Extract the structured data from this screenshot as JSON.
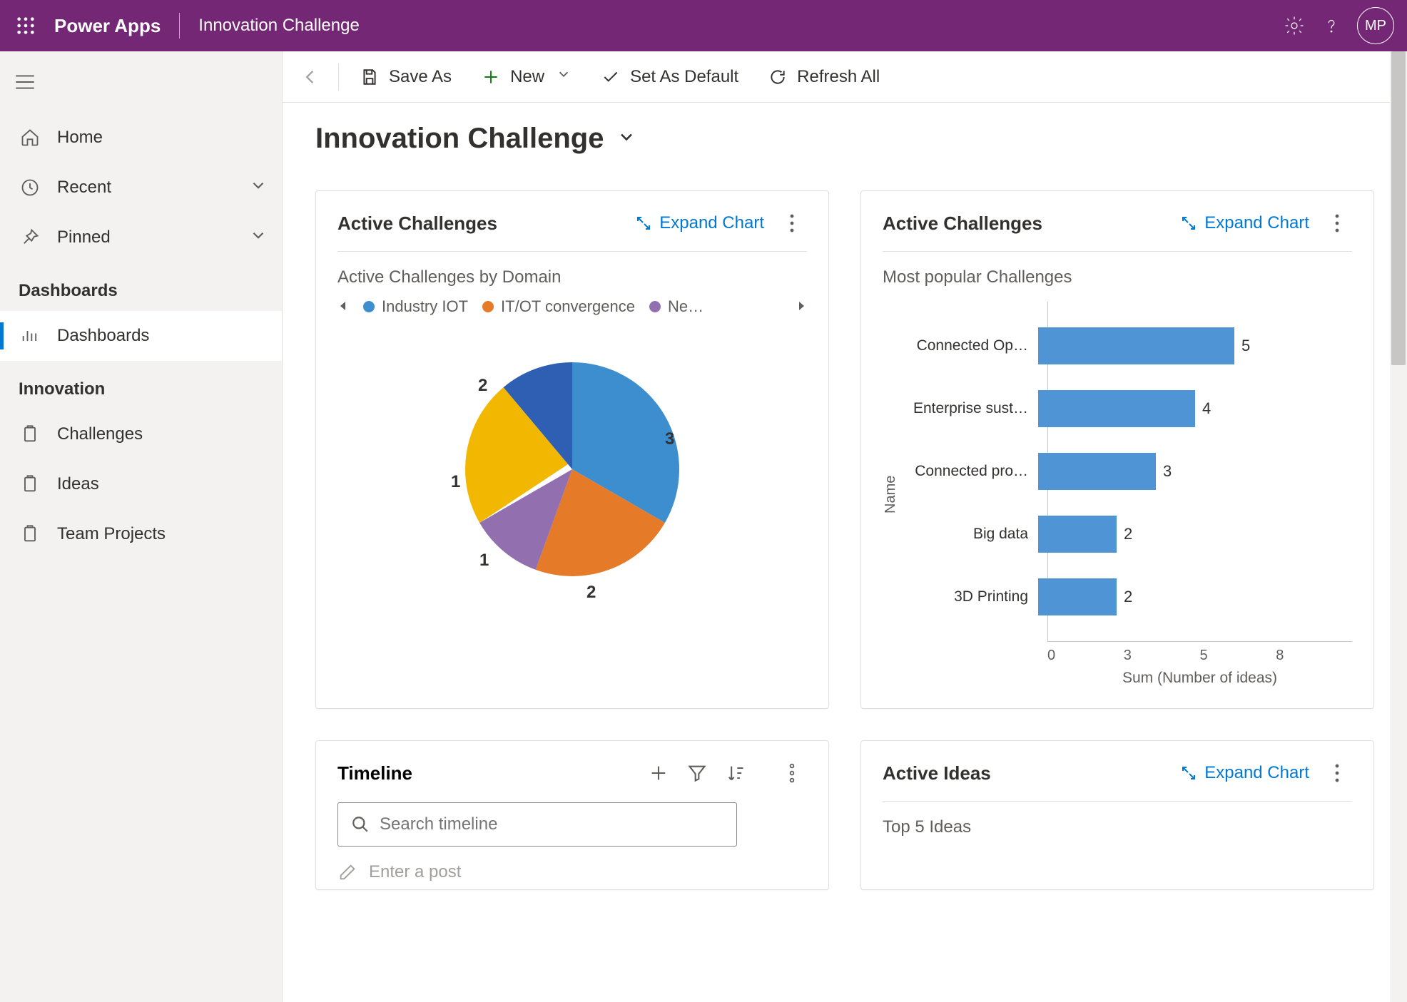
{
  "topbar": {
    "brand": "Power Apps",
    "appName": "Innovation Challenge",
    "avatar": "MP"
  },
  "sidebar": {
    "items": [
      {
        "id": "home",
        "label": "Home"
      },
      {
        "id": "recent",
        "label": "Recent",
        "chev": true
      },
      {
        "id": "pinned",
        "label": "Pinned",
        "chev": true
      }
    ],
    "section1": "Dashboards",
    "dashboards": "Dashboards",
    "section2": "Innovation",
    "innovation": [
      {
        "id": "challenges",
        "label": "Challenges"
      },
      {
        "id": "ideas",
        "label": "Ideas"
      },
      {
        "id": "team-projects",
        "label": "Team Projects"
      }
    ]
  },
  "commands": {
    "saveAs": "Save As",
    "new": "New",
    "setDefault": "Set As Default",
    "refresh": "Refresh All"
  },
  "pageTitle": "Innovation Challenge",
  "panels": {
    "pie": {
      "title": "Active Challenges",
      "expand": "Expand Chart",
      "subtitle": "Active Challenges by Domain"
    },
    "bar": {
      "title": "Active Challenges",
      "expand": "Expand Chart",
      "subtitle": "Most popular Challenges",
      "ylabel": "Name",
      "xlabel": "Sum (Number of ideas)"
    },
    "timeline": {
      "title": "Timeline",
      "searchPh": "Search timeline",
      "postPh": "Enter a post"
    },
    "ideas": {
      "title": "Active Ideas",
      "expand": "Expand Chart",
      "subtitle": "Top 5 Ideas"
    }
  },
  "chart_data": [
    {
      "type": "pie",
      "title": "Active Challenges by Domain",
      "categories": [
        "Industry IOT",
        "IT/OT convergence",
        "Ne…",
        "(blue)",
        "(yellow)"
      ],
      "values": [
        3,
        2,
        1,
        2,
        1
      ],
      "colors": [
        "#3d8ecf",
        "#e57b29",
        "#9270b0",
        "#2f5fb3",
        "#f2b700"
      ],
      "legend": [
        "Industry IOT",
        "IT/OT convergence",
        "Ne…"
      ]
    },
    {
      "type": "bar",
      "orientation": "horizontal",
      "title": "Most popular Challenges",
      "ylabel": "Name",
      "xlabel": "Sum (Number of ideas)",
      "xticks": [
        0,
        3,
        5,
        8
      ],
      "categories": [
        "Connected Op…",
        "Enterprise sust…",
        "Connected pro…",
        "Big data",
        "3D Printing"
      ],
      "values": [
        5,
        4,
        3,
        2,
        2
      ]
    }
  ]
}
